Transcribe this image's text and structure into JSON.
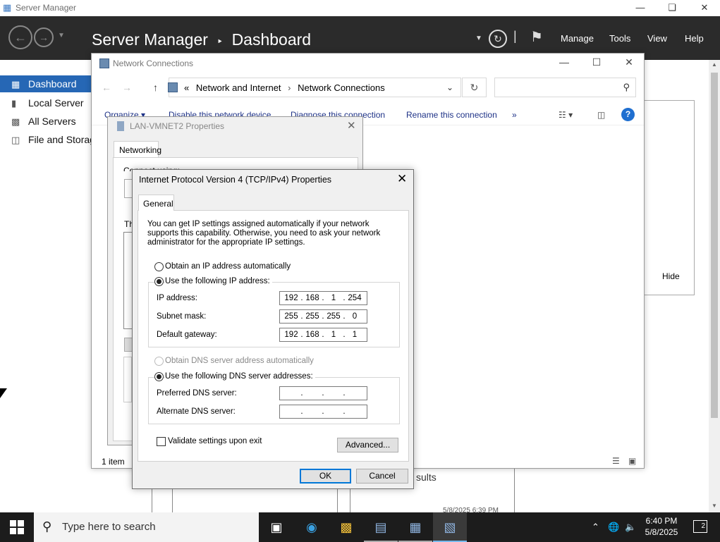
{
  "server_manager": {
    "window_title": "Server Manager",
    "breadcrumb_app": "Server Manager",
    "breadcrumb_sep": "‣",
    "breadcrumb_page": "Dashboard",
    "menus": [
      "Manage",
      "Tools",
      "View",
      "Help"
    ],
    "sidebar": [
      {
        "label": "Dashboard",
        "icon": "dashboard-icon",
        "active": true
      },
      {
        "label": "Local Server",
        "icon": "server-icon"
      },
      {
        "label": "All Servers",
        "icon": "servers-icon"
      },
      {
        "label": "File and Storag",
        "icon": "storage-icon"
      }
    ],
    "hide_label": "Hide",
    "background_text": "sults",
    "background_date": "5/8/2025 6:39 PM"
  },
  "network_connections": {
    "title": "Network Connections",
    "address_prefix": "«",
    "address_crumbs": [
      "Network and Internet",
      "Network Connections"
    ],
    "search_placeholder": "",
    "toolbar": {
      "organize": "Organize ▾",
      "disable": "Disable this network device",
      "diagnose": "Diagnose this connection",
      "rename": "Rename this connection",
      "more": "»"
    },
    "status": "1 item"
  },
  "lan_properties": {
    "title": "LAN-VMNET2 Properties",
    "tab": "Networking",
    "fragment_connect": "Connect using:",
    "fragment_this": "Th"
  },
  "ipv4": {
    "title": "Internet Protocol Version 4 (TCP/IPv4) Properties",
    "tab": "General",
    "intro": "You can get IP settings assigned automatically if your network supports this capability. Otherwise, you need to ask your network administrator for the appropriate IP settings.",
    "ip_auto_label": "Obtain an IP address automatically",
    "ip_manual_label": "Use the following IP address:",
    "ip_address_label": "IP address:",
    "ip_address": [
      "192",
      "168",
      "1",
      "254"
    ],
    "subnet_label": "Subnet mask:",
    "subnet": [
      "255",
      "255",
      "255",
      "0"
    ],
    "gateway_label": "Default gateway:",
    "gateway": [
      "192",
      "168",
      "1",
      "1"
    ],
    "dns_auto_label": "Obtain DNS server address automatically",
    "dns_manual_label": "Use the following DNS server addresses:",
    "preferred_dns_label": "Preferred DNS server:",
    "preferred_dns": [
      "",
      "",
      "",
      ""
    ],
    "alternate_dns_label": "Alternate DNS server:",
    "alternate_dns": [
      "",
      "",
      "",
      ""
    ],
    "validate_label": "Validate settings upon exit",
    "advanced_button": "Advanced...",
    "ok_button": "OK",
    "cancel_button": "Cancel"
  },
  "taskbar": {
    "search_placeholder": "Type here to search",
    "apps": [
      "task-view-icon",
      "edge-icon",
      "file-explorer-icon",
      "server-manager-icon",
      "network-icon",
      "control-panel-icon"
    ],
    "time": "6:40 PM",
    "date": "5/8/2025",
    "notification_count": "2"
  },
  "colors": {
    "sm_header": "#2b2b2b",
    "sidebar_active": "#2667b5",
    "link_blue": "#1e3287",
    "default_button_border": "#0078d7",
    "taskbar": "#1c1c1c"
  }
}
